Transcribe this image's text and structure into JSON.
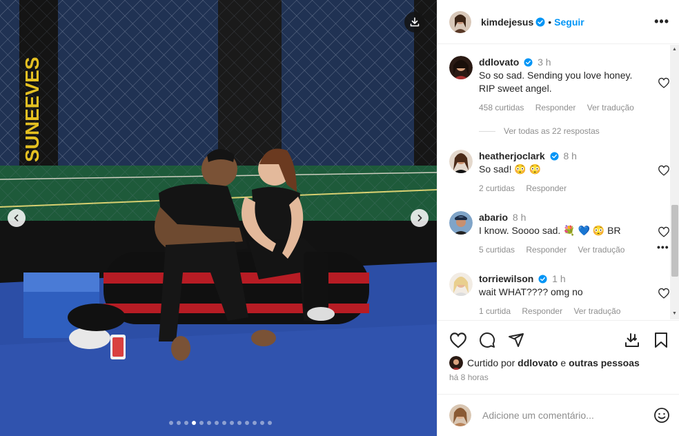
{
  "post": {
    "username": "kimdejesus",
    "follow_label": "Seguir",
    "separator": "•",
    "more_label": "•••"
  },
  "carousel": {
    "total_slides": 14,
    "active_index": 3
  },
  "comments": [
    {
      "username": "ddlovato",
      "verified": true,
      "time": "3 h",
      "text": "So so sad. Sending you love honey. RIP sweet angel.",
      "likes": "458 curtidas",
      "reply": "Responder",
      "translate": "Ver tradução",
      "avatar_color": "#3a2a20"
    },
    {
      "username": "heatherjoclark",
      "verified": true,
      "time": "8 h",
      "text": "So sad! 😳 😳",
      "likes": "2 curtidas",
      "reply": "Responder",
      "translate": "",
      "avatar_color": "#6b5040"
    },
    {
      "username": "abario",
      "verified": false,
      "time": "8 h",
      "text": "I know. Soooo sad. 💐 💙 😳 BR",
      "likes": "5 curtidas",
      "reply": "Responder",
      "translate": "Ver tradução",
      "avatar_color": "#5a7fa6"
    },
    {
      "username": "torriewilson",
      "verified": true,
      "time": "1 h",
      "text": "wait WHAT???? omg no",
      "likes": "1 curtida",
      "reply": "Responder",
      "translate": "Ver tradução",
      "avatar_color": "#e8d3b0"
    }
  ],
  "view_replies": "Ver todas as 22 respostas",
  "liked_by": {
    "prefix": "Curtido por",
    "user": "ddlovato",
    "connector": "e",
    "others": "outras pessoas"
  },
  "time_ago": "há 8 horas",
  "add_comment": {
    "placeholder": "Adicione um comentário..."
  },
  "icons": {
    "like": "heart-icon",
    "comment": "comment-icon",
    "share": "share-icon",
    "save": "bookmark-icon",
    "download": "download-icon",
    "emoji": "emoji-icon"
  },
  "colors": {
    "accent": "#0095f6",
    "verified": "#0095f6",
    "muted": "#8e8e8e",
    "text": "#262626"
  }
}
